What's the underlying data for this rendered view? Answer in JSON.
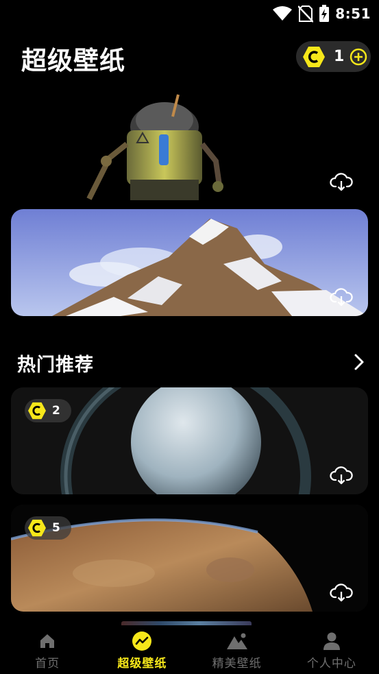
{
  "status_bar": {
    "time": "8:51"
  },
  "header": {
    "title": "超级壁纸",
    "coin_count": "1"
  },
  "section": {
    "title": "热门推荐"
  },
  "cards": [
    {
      "price": "2",
      "name": "saturn-like planet"
    },
    {
      "price": "5",
      "name": "desert planet"
    }
  ],
  "nav": {
    "items": [
      {
        "label": "首页",
        "icon": "home-icon"
      },
      {
        "label": "超级壁纸",
        "icon": "wave-icon",
        "active": true
      },
      {
        "label": "精美壁纸",
        "icon": "mountain-image-icon"
      },
      {
        "label": "个人中心",
        "icon": "person-icon"
      }
    ]
  },
  "colors": {
    "accent": "#f6e71a",
    "background": "#000000",
    "inactive": "#6f6f6f"
  }
}
